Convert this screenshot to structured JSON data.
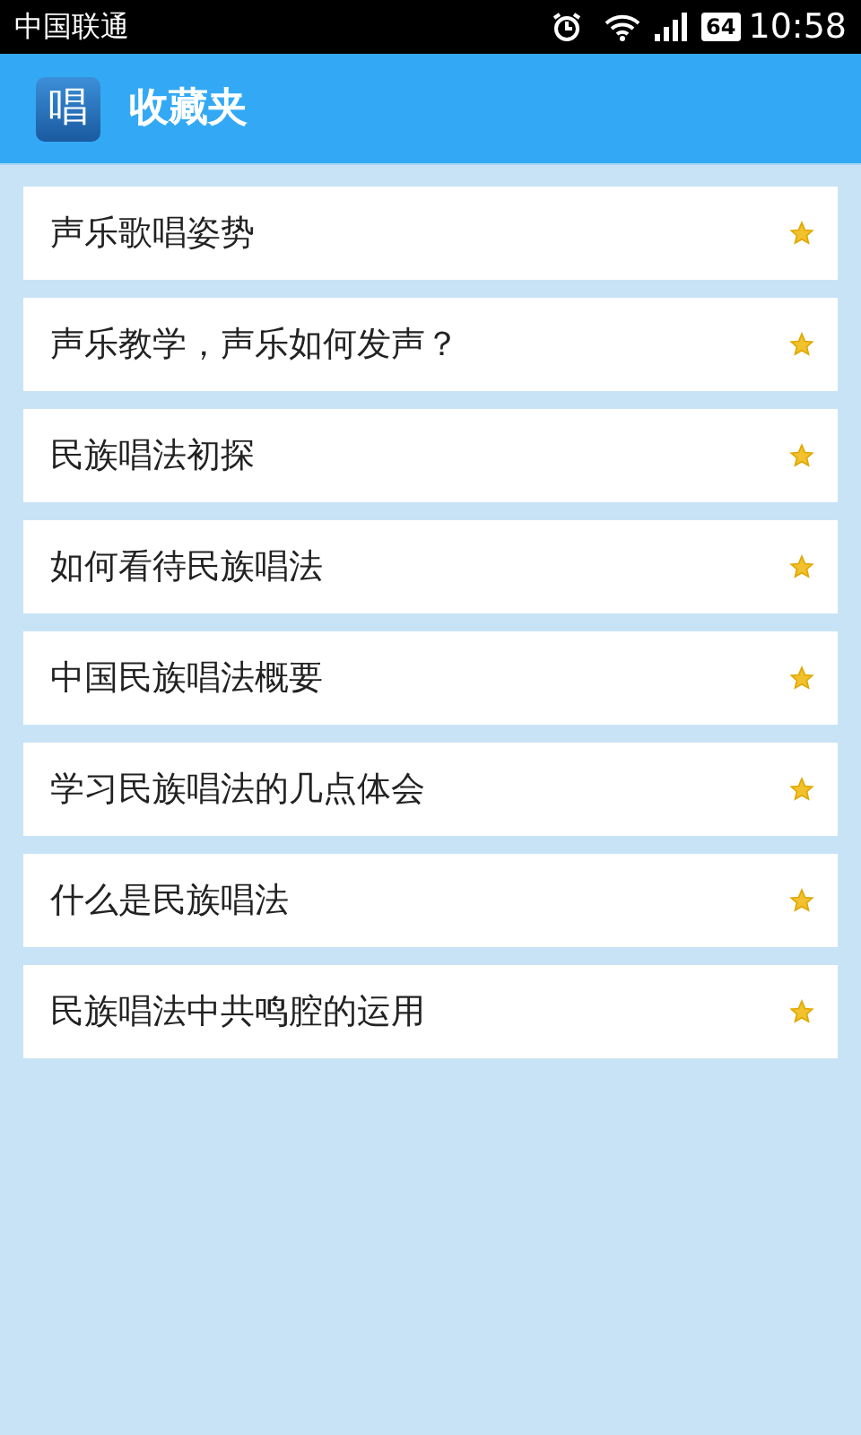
{
  "status_bar": {
    "carrier": "中国联通",
    "battery": "64",
    "time": "10:58"
  },
  "header": {
    "app_icon_text": "唱",
    "title": "收藏夹"
  },
  "favorites": [
    {
      "title": "声乐歌唱姿势",
      "starred": true
    },
    {
      "title": "声乐教学，声乐如何发声？",
      "starred": true
    },
    {
      "title": "民族唱法初探",
      "starred": true
    },
    {
      "title": "如何看待民族唱法",
      "starred": true
    },
    {
      "title": "中国民族唱法概要",
      "starred": true
    },
    {
      "title": "学习民族唱法的几点体会",
      "starred": true
    },
    {
      "title": "什么是民族唱法",
      "starred": true
    },
    {
      "title": "民族唱法中共鸣腔的运用",
      "starred": true
    }
  ]
}
